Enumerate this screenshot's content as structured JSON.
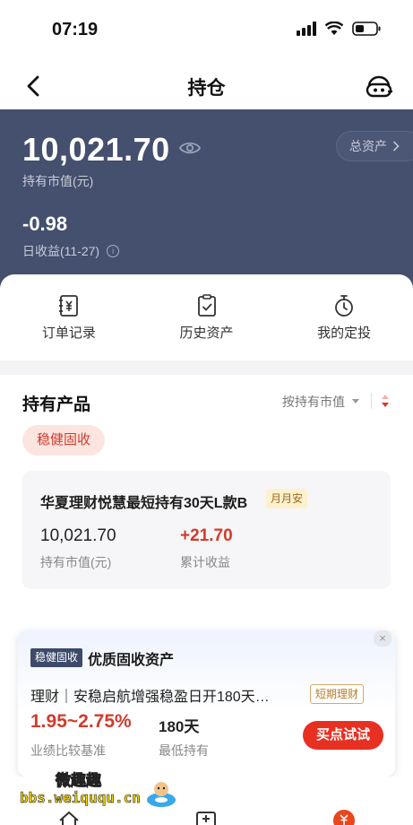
{
  "status_bar": {
    "time": "07:19"
  },
  "nav": {
    "title": "持仓"
  },
  "hero": {
    "market_value": "10,021.70",
    "market_value_label": "持有市值(元)",
    "total_assets_label": "总资产",
    "daily_income": "-0.98",
    "daily_income_label": "日收益(11-27)"
  },
  "quick_actions": [
    {
      "label": "订单记录",
      "icon": "receipt-yen-icon"
    },
    {
      "label": "历史资产",
      "icon": "clipboard-check-icon"
    },
    {
      "label": "我的定投",
      "icon": "stopwatch-icon"
    }
  ],
  "holdings": {
    "title": "持有产品",
    "sort_label": "按持有市值",
    "filter_chip": "稳健固收",
    "product": {
      "name": "华夏理财悦慧最短持有30天L款B",
      "tag": "月月安",
      "market_value": "10,021.70",
      "market_value_label": "持有市值(元)",
      "cumulative_income": "+21.70",
      "cumulative_income_label": "累计收益"
    }
  },
  "promo": {
    "badge": "稳健固收",
    "heading": "优质固收资产",
    "product": "理财｜安稳启航增强稳盈日开180天…",
    "term_tag": "短期理财",
    "rate": "1.95~2.75%",
    "rate_label": "业绩比较基准",
    "hold_period": "180天",
    "hold_label": "最低持有",
    "cta": "买点试试",
    "close": "×"
  },
  "watermark": {
    "top": "微趣趣",
    "url": "bbs.weiququ.cn"
  },
  "colors": {
    "hero_bg": "#454f6e",
    "accent_red": "#d13b2c",
    "cta_red": "#e83022"
  }
}
